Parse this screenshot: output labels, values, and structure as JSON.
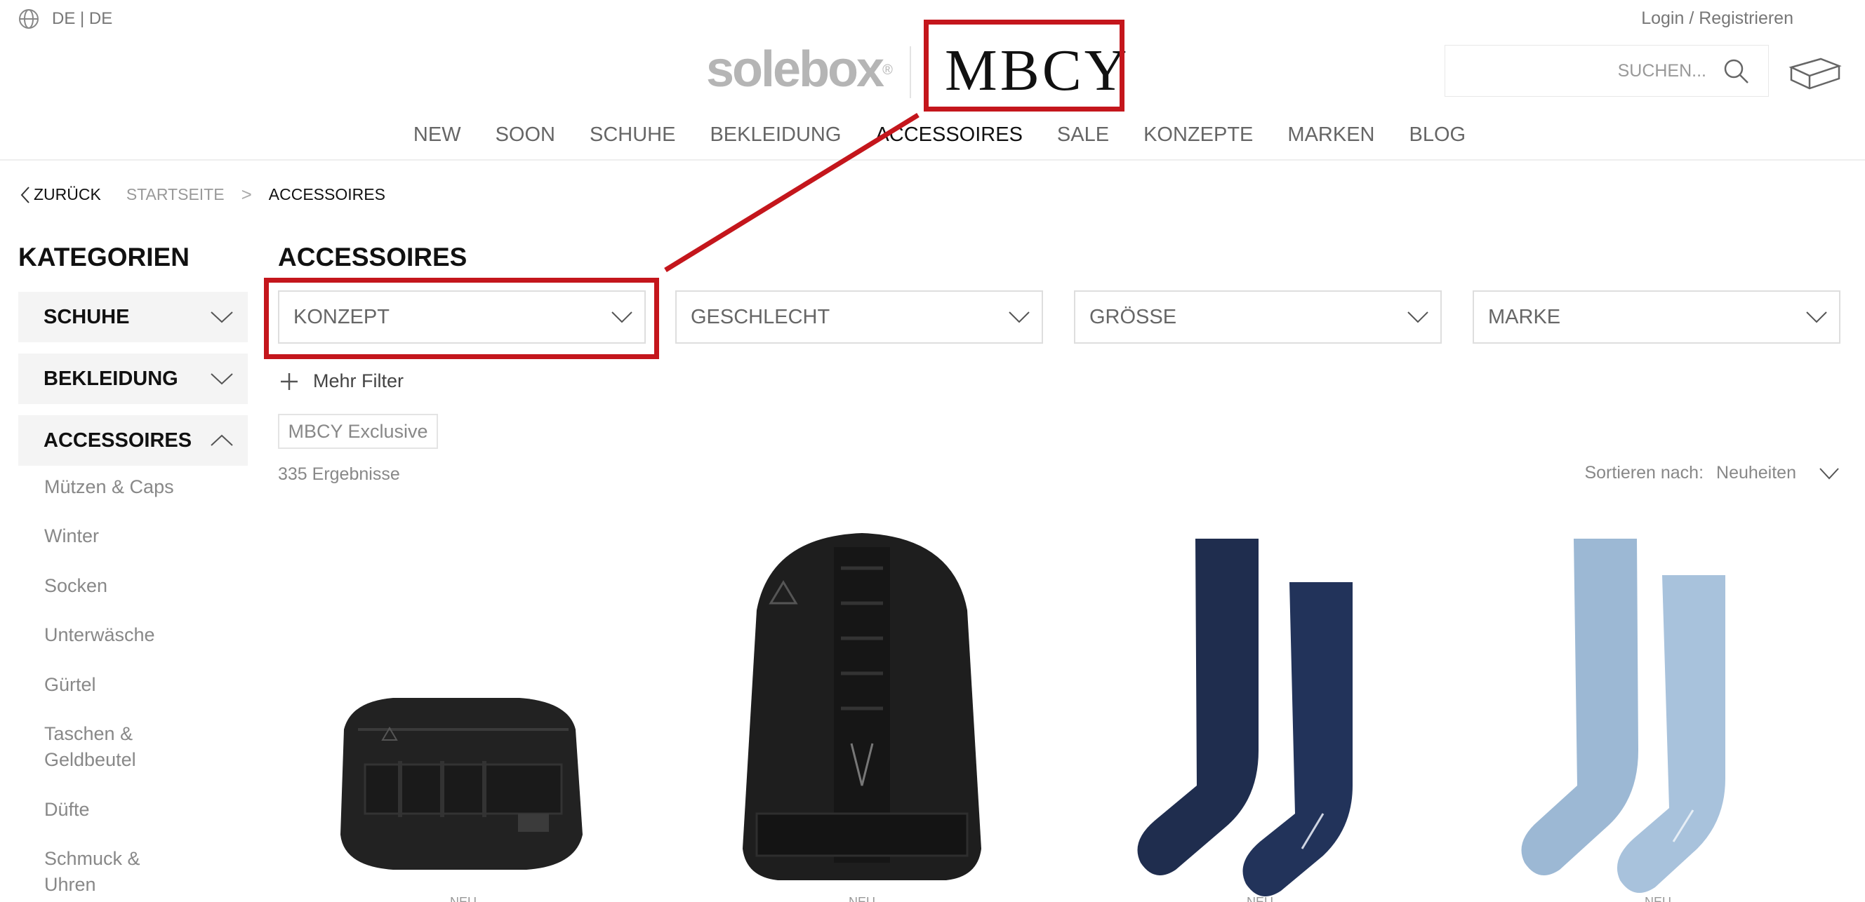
{
  "topbar": {
    "language": "DE | DE",
    "login": "Login / Registrieren",
    "icons": {
      "language": "globe-icon"
    }
  },
  "logos": {
    "solebox": "solebox",
    "registered": "®",
    "mbcy": "MBCY"
  },
  "search": {
    "placeholder": "SUCHEN...",
    "icons": {
      "search": "search-icon",
      "cart": "box-icon"
    }
  },
  "nav": {
    "items": [
      "NEW",
      "SOON",
      "SCHUHE",
      "BEKLEIDUNG",
      "ACCESSOIRES",
      "SALE",
      "KONZEPTE",
      "MARKEN",
      "BLOG"
    ],
    "active": "ACCESSOIRES"
  },
  "breadcrumb": {
    "back": "ZURÜCK",
    "home": "STARTSEITE",
    "separator": ">",
    "current": "ACCESSOIRES"
  },
  "sidebar": {
    "title": "KATEGORIEN",
    "categories": [
      "SCHUHE",
      "BEKLEIDUNG",
      "ACCESSOIRES"
    ],
    "subcategories": [
      "Mützen & Caps",
      "Winter",
      "Socken",
      "Unterwäsche",
      "Gürtel",
      "Taschen &",
      "Geldbeutel",
      "Düfte",
      "Schmuck &",
      "Uhren"
    ]
  },
  "main": {
    "title": "ACCESSOIRES",
    "filters": [
      "KONZEPT",
      "GESCHLECHT",
      "GRÖSSE",
      "MARKE"
    ],
    "more_filters": "Mehr Filter",
    "active_tag": "MBCY Exclusive",
    "results": "335 Ergebnisse",
    "sort_label": "Sortieren nach:",
    "sort_value": "Neuheiten"
  },
  "products": [
    {
      "name": "hip-bag",
      "badge": "NEU"
    },
    {
      "name": "backpack",
      "badge": "NEU"
    },
    {
      "name": "navy-socks",
      "badge": "NEU"
    },
    {
      "name": "light-blue-socks",
      "badge": "NEU"
    }
  ],
  "colors": {
    "annotation_red": "#c4161c",
    "accent_text": "#111111",
    "muted_text": "#888888",
    "panel_bg": "#f4f4f4"
  }
}
